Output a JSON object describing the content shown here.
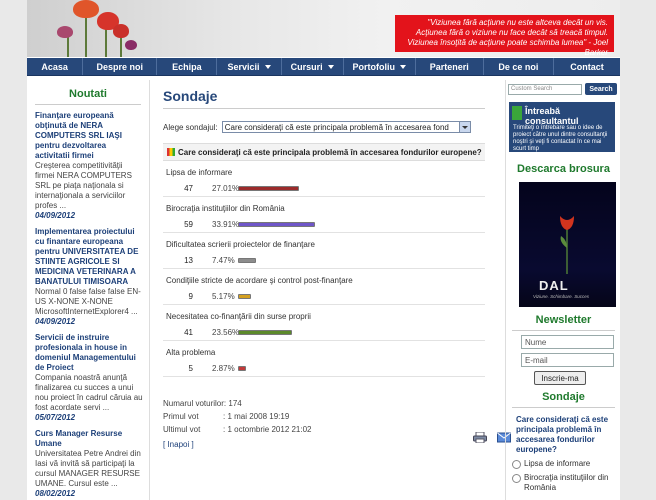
{
  "header": {
    "quote_lines": [
      "\"Viziunea fără acţiune nu este altceva decât un vis.",
      "Acţiunea fără o viziune nu face decât să treacă timpul.",
      "Viziunea însoţită de acţiune poate schimba lumea\" - Joel Barker"
    ]
  },
  "nav": {
    "items": [
      {
        "label": "Acasa",
        "dropdown": false
      },
      {
        "label": "Despre noi",
        "dropdown": false
      },
      {
        "label": "Echipa",
        "dropdown": false
      },
      {
        "label": "Servicii",
        "dropdown": true
      },
      {
        "label": "Cursuri",
        "dropdown": true
      },
      {
        "label": "Portofoliu",
        "dropdown": true
      },
      {
        "label": "Parteneri",
        "dropdown": false
      },
      {
        "label": "De ce noi",
        "dropdown": false
      },
      {
        "label": "Contact",
        "dropdown": false
      }
    ]
  },
  "left": {
    "title": "Noutati",
    "news": [
      {
        "title": "Finanţare europeană obţinută de NERA COMPUTERS SRL IAŞI pentru dezvoltarea activitatii firmei",
        "body": "Creşterea competitivităţii firmei NERA COMPUTERS SRL pe piaţa naţionala si internaţionala a serviciilor profes ...",
        "date": "04/09/2012"
      },
      {
        "title": "Implementarea proiectului cu finantare europeana pentru UNIVERSITATEA DE STIINTE AGRICOLE SI MEDICINA VETERINARA A BANATULUI TIMISOARA",
        "body": "Normal 0 false false false EN-US X-NONE X-NONE MicrosoftInternetExplorer4 ...",
        "date": "04/09/2012"
      },
      {
        "title": "Servicii de instruire profesionala in house in domeniul Managementului de Proiect",
        "body": "Compania noastră anunţă finalizarea cu succes a unui nou proiect în cadrul căruia au fost acordate servi ...",
        "date": "05/07/2012"
      },
      {
        "title": "Curs Manager Resurse Umane",
        "body": "Universitatea Petre Andrei din Iasi vă invită să participaţi la cursul MANAGER RESURSE UMANE. Cursul este ...",
        "date": "08/02/2012"
      }
    ]
  },
  "main": {
    "title": "Sondaje",
    "select_label": "Alege sondajul:",
    "select_value": "Care considerați că este principala problemă în accesarea fond",
    "question": "Care consideraţi că este principala problemă în accesarea fondurilor europene?",
    "options": [
      {
        "label": "Lipsa de informare",
        "votes": "47",
        "percent": "27.01%",
        "pct": 27.01,
        "color": "#9b2b2b"
      },
      {
        "label": "Birocraţia instituţiilor din România",
        "votes": "59",
        "percent": "33.91%",
        "pct": 33.91,
        "color": "#6f56c8"
      },
      {
        "label": "Dificultatea scrierii proiectelor de finanţare",
        "votes": "13",
        "percent": "7.47%",
        "pct": 7.47,
        "color": "#8c8c8c"
      },
      {
        "label": "Condiţiile stricte de acordare şi control post-finanţare",
        "votes": "9",
        "percent": "5.17%",
        "pct": 5.17,
        "color": "#d4a020"
      },
      {
        "label": "Necesitatea co-finanţării din surse proprii",
        "votes": "41",
        "percent": "23.56%",
        "pct": 23.56,
        "color": "#5c8a2b"
      },
      {
        "label": "Alta problema",
        "votes": "5",
        "percent": "2.87%",
        "pct": 2.87,
        "color": "#c23a3a"
      }
    ],
    "stats": {
      "votes_label": "Numarul voturilor:",
      "votes_value": "174",
      "first_label": "Primul vot",
      "first_value": ": 1 mai 2008 19:19",
      "last_label": "Ultimul vot",
      "last_value": ": 1 octombrie 2012 21:02"
    },
    "back_link": "[ Inapoi ]"
  },
  "right": {
    "search_placeholder": "Custom Search",
    "search_button": "Search",
    "consult_title": "Întreabă consultantul",
    "consult_body": "Trimiteţi o întrebare sau o idee de proiect către unul dintre consultanţii noştri şi veţi fi contactat în ce mai scurt timp",
    "brochure_title": "Descarca brosura",
    "brochure_logo": "DAL",
    "brochure_sub": "Viziune. Schimbare. Succes",
    "newsletter_title": "Newsletter",
    "name_placeholder": "Nume",
    "email_placeholder": "E-mail",
    "subscribe_button": "Inscrie-ma",
    "poll_title": "Sondaje",
    "poll_question": "Care consideraţi că este principala problemă în accesarea fondurilor europene?",
    "poll_options": [
      "Lipsa de informare",
      "Birocraţia instituţiilor din România"
    ]
  },
  "colors": {
    "nav": "#27487a",
    "heading": "#1f7a2d",
    "link": "#1c3f78",
    "quote_bg": "#e3131b"
  }
}
